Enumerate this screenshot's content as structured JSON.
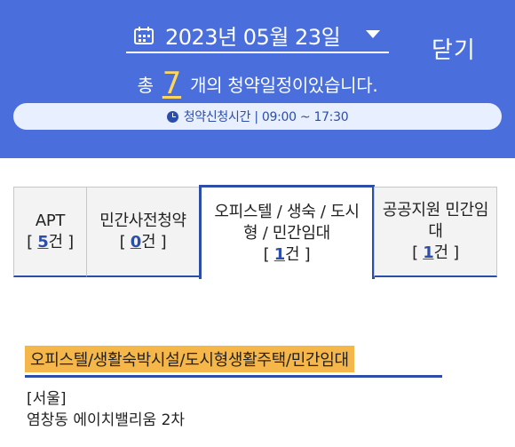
{
  "header": {
    "date": "2023년 05월 23일",
    "close_label": "닫기",
    "summary_prefix": "총",
    "summary_count": "7",
    "summary_suffix": "개의 청약일정이있습니다.",
    "time_info": "청약신청시간 | 09:00 ~ 17:30"
  },
  "tabs": [
    {
      "label_line1": "APT",
      "label_line2": "",
      "count": "5",
      "count_unit": "건"
    },
    {
      "label_line1": "민간사전청약",
      "label_line2": "",
      "count": "0",
      "count_unit": "건"
    },
    {
      "label_line1": "오피스텔 / 생숙 / 도시",
      "label_line2": "형 / 민간임대",
      "count": "1",
      "count_unit": "건"
    },
    {
      "label_line1": "공공지원 민간임",
      "label_line2": "대",
      "count": "1",
      "count_unit": "건"
    }
  ],
  "content": {
    "category": "오피스텔/생활숙박시설/도시형생활주택/민간임대",
    "region": "[서울]",
    "complex_name": "염창동 에이치밸리움 2차"
  },
  "colors": {
    "header_bg": "#4a6fdc",
    "accent": "#2d4ea8",
    "highlight": "#f5b64a",
    "count_yellow": "#ffd65c"
  }
}
